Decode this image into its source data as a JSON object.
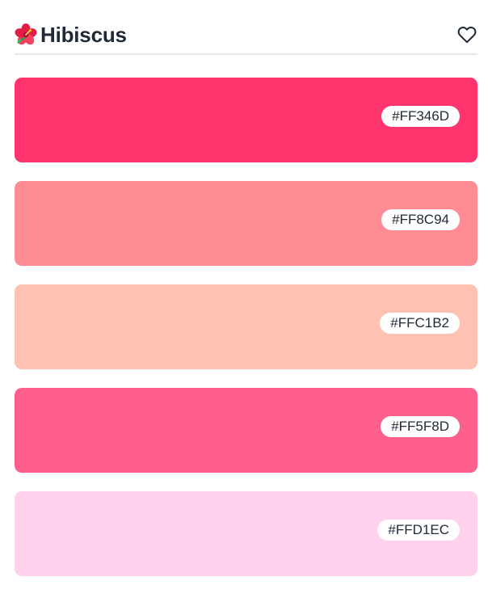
{
  "header": {
    "title": "Hibiscus",
    "emoji_icon": "hibiscus-flower-icon",
    "favorite_icon": "heart-outline-icon"
  },
  "palette": {
    "colors": [
      {
        "hex": "#FF346D",
        "color": "#FF346D"
      },
      {
        "hex": "#FF8C94",
        "color": "#FF8C94"
      },
      {
        "hex": "#FFC1B2",
        "color": "#FFC1B2"
      },
      {
        "hex": "#FF5F8D",
        "color": "#FF5F8D"
      },
      {
        "hex": "#FFD1EC",
        "color": "#FFD1EC"
      }
    ]
  },
  "colors": {
    "title_text": "#1f2937",
    "divider": "#e5e7eb",
    "pill_background": "#ffffff"
  }
}
